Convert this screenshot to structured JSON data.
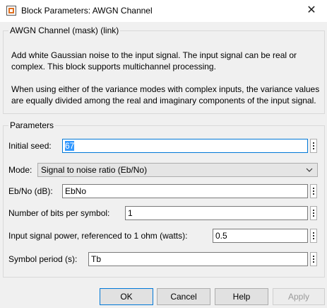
{
  "window": {
    "title": "Block Parameters: AWGN Channel",
    "close_symbol": "✕"
  },
  "mask": {
    "heading": "AWGN Channel (mask) (link)",
    "desc1": "Add white Gaussian noise to the input signal. The input signal can be real or complex. This block supports multichannel processing.",
    "desc2": "When using either of the variance modes with complex inputs, the variance values are equally divided among the real and imaginary components of the input signal."
  },
  "params": {
    "heading": "Parameters",
    "initial_seed": {
      "label": "Initial seed:",
      "value": "67"
    },
    "mode": {
      "label": "Mode:",
      "value": "Signal to noise ratio  (Eb/No)"
    },
    "ebno": {
      "label": "Eb/No (dB):",
      "value": "EbNo"
    },
    "bits_per_symbol": {
      "label": "Number of bits per symbol:",
      "value": "1"
    },
    "input_power": {
      "label": "Input signal power, referenced to 1 ohm (watts):",
      "value": "0.5"
    },
    "symbol_period": {
      "label": "Symbol period (s):",
      "value": "Tb"
    }
  },
  "buttons": {
    "ok": "OK",
    "cancel": "Cancel",
    "help": "Help",
    "apply": "Apply"
  },
  "icons": {
    "app": "simulink-block-icon",
    "close": "close-icon",
    "more": "vertical-dots-icon",
    "dropdown": "chevron-down-icon"
  }
}
